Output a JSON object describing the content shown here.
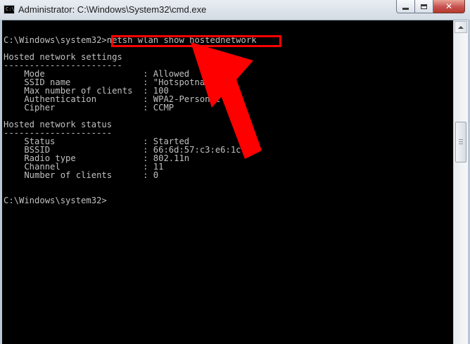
{
  "window": {
    "title": "Administrator: C:\\Windows\\System32\\cmd.exe",
    "icon": "cmd-icon",
    "icon_text": "C:\\",
    "controls": [
      "minimize-icon",
      "maximize-icon",
      "close-icon"
    ],
    "close_glyph": "✕"
  },
  "console": {
    "text": "C:\\Windows\\system32>netsh wlan show hostednetwork\n\nHosted network settings\n-----------------------\n    Mode                   : Allowed\n    SSID name              : \"Hotspotname\"\n    Max number of clients  : 100\n    Authentication         : WPA2-Personal\n    Cipher                 : CCMP\n\nHosted network status\n---------------------\n    Status                 : Started\n    BSSID                  : 66:6d:57:c3:e6:1c\n    Radio type             : 802.11n\n    Channel                : 11\n    Number of clients      : 0\n\n\nC:\\Windows\\system32>"
  },
  "annotation": {
    "highlighted_command": "netsh wlan show hostednetwork",
    "highlight_color": "#ff0000",
    "arrow_color": "#ff0000"
  },
  "colors": {
    "console_background": "#000000",
    "console_text": "#c0c0c0"
  }
}
